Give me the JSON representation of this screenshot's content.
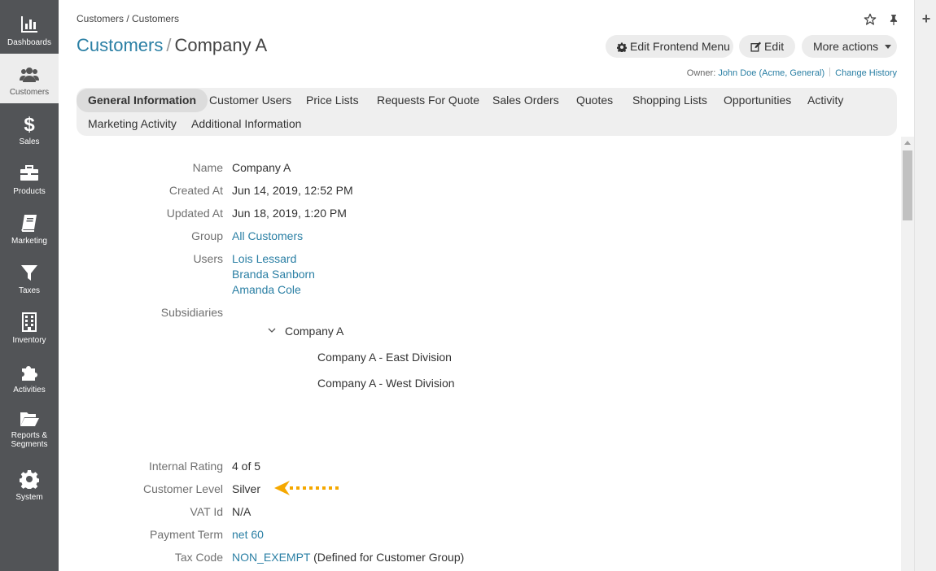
{
  "sidebar": {
    "items": [
      {
        "label": "Dashboards",
        "icon": "bar-chart-icon"
      },
      {
        "label": "Customers",
        "icon": "users-icon",
        "active": true
      },
      {
        "label": "Sales",
        "icon": "dollar-icon"
      },
      {
        "label": "Products",
        "icon": "briefcase-icon"
      },
      {
        "label": "Marketing",
        "icon": "book-icon"
      },
      {
        "label": "Taxes",
        "icon": "filter-icon"
      },
      {
        "label": "Inventory",
        "icon": "building-icon"
      },
      {
        "label": "Activities",
        "icon": "puzzle-icon"
      },
      {
        "label": "Reports &",
        "label2": "Segments",
        "icon": "folder-open-icon"
      },
      {
        "label": "System",
        "icon": "gear-icon"
      }
    ]
  },
  "header": {
    "breadcrumb": "Customers / Customers",
    "title_link": "Customers",
    "title_sep": "/",
    "title_entity": "Company A",
    "buttons": {
      "edit_frontend_menu": "Edit Frontend Menu",
      "edit": "Edit",
      "more_actions": "More actions"
    },
    "owner_prefix": "Owner: ",
    "owner_name": "John Doe",
    "owner_org": "(Acme, General)",
    "change_history": "Change History"
  },
  "tabs": [
    "General Information",
    "Customer Users",
    "Price Lists",
    "Requests For Quote",
    "Sales Orders",
    "Quotes",
    "Shopping Lists",
    "Opportunities",
    "Activity",
    "Marketing Activity",
    "Additional Information"
  ],
  "details": {
    "name_label": "Name",
    "name": "Company A",
    "created_label": "Created At",
    "created": "Jun 14, 2019, 12:52 PM",
    "updated_label": "Updated At",
    "updated": "Jun 18, 2019, 1:20 PM",
    "group_label": "Group",
    "group": "All Customers",
    "users_label": "Users",
    "users": [
      "Lois Lessard",
      "Branda Sanborn",
      "Amanda Cole"
    ],
    "subsidiaries_label": "Subsidiaries",
    "subsidiaries_root": "Company A",
    "subsidiaries_children": [
      "Company A - East Division",
      "Company A - West Division"
    ],
    "rating_label": "Internal Rating",
    "rating": "4 of 5",
    "level_label": "Customer Level",
    "level": "Silver",
    "vat_label": "VAT Id",
    "vat": "N/A",
    "payment_label": "Payment Term",
    "payment": "net 60",
    "tax_label": "Tax Code",
    "tax": "NON_EXEMPT",
    "tax_note": "(Defined for Customer Group)"
  },
  "colors": {
    "sidebar_bg": "#525457",
    "link": "#2a7fa4",
    "annotation": "#f5a800"
  }
}
